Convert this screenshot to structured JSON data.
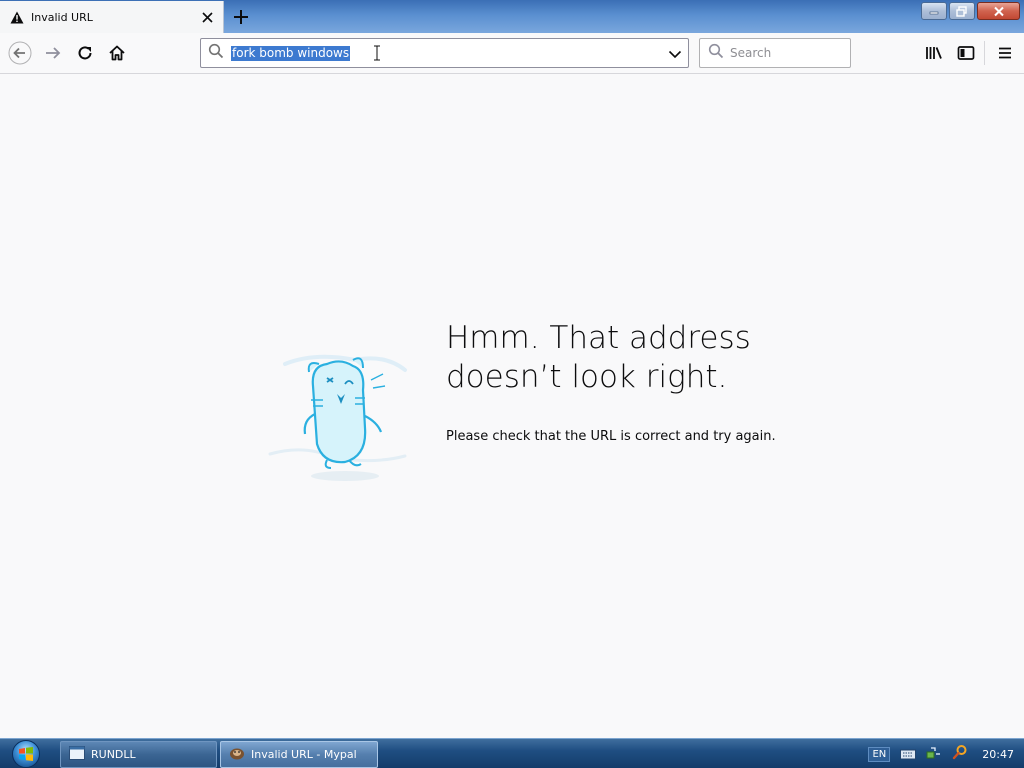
{
  "window": {
    "tab_title": "Invalid URL",
    "tab_icon": "warning-icon",
    "new_tab_icon": "plus-icon",
    "controls": [
      "minimize-icon",
      "restore-icon",
      "close-icon"
    ]
  },
  "toolbar": {
    "back_icon": "arrow-left-icon",
    "forward_icon": "arrow-right-icon",
    "reload_icon": "reload-icon",
    "home_icon": "home-icon",
    "url_value": "fork bomb windows",
    "search_placeholder": "Search",
    "library_icon": "library-icon",
    "sidebar_icon": "sidebar-icon",
    "menu_icon": "hamburger-icon"
  },
  "error_page": {
    "title": "Hmm. That address doesn’t look right.",
    "description": "Please check that the URL is correct and try again.",
    "illustration": "confused-hamster-illustration"
  },
  "taskbar": {
    "items": [
      {
        "label": "RUNDLL",
        "icon": "window-icon"
      },
      {
        "label": "Invalid URL - Mypal",
        "icon": "mypal-icon"
      }
    ],
    "language": "EN",
    "clock": "20:47"
  },
  "colors": {
    "selection": "#3d7ad0",
    "page_background": "#f9f9fa",
    "taskbar": "#1f4e82"
  }
}
